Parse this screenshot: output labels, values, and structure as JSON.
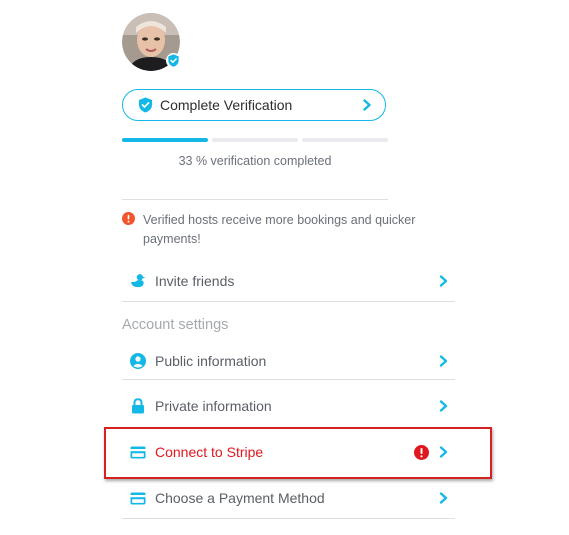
{
  "colors": {
    "accent": "#14b8e6",
    "alert": "#e0181e",
    "warning": "#f2552c"
  },
  "profile": {
    "avatar_icon": "verified-badge-icon"
  },
  "verification": {
    "button_label": "Complete Verification",
    "progress_percent": 33,
    "progress_segments": 3,
    "progress_filled": 1,
    "progress_text": "33 % verification completed"
  },
  "warning": {
    "icon": "exclamation-circle-icon",
    "text": "Verified hosts receive more bookings and quicker payments!"
  },
  "menu": {
    "invite_friends": "Invite friends",
    "section_title": "Account settings",
    "public_information": "Public information",
    "private_information": "Private information",
    "connect_stripe": "Connect to Stripe",
    "payment_method": "Choose a Payment Method"
  }
}
